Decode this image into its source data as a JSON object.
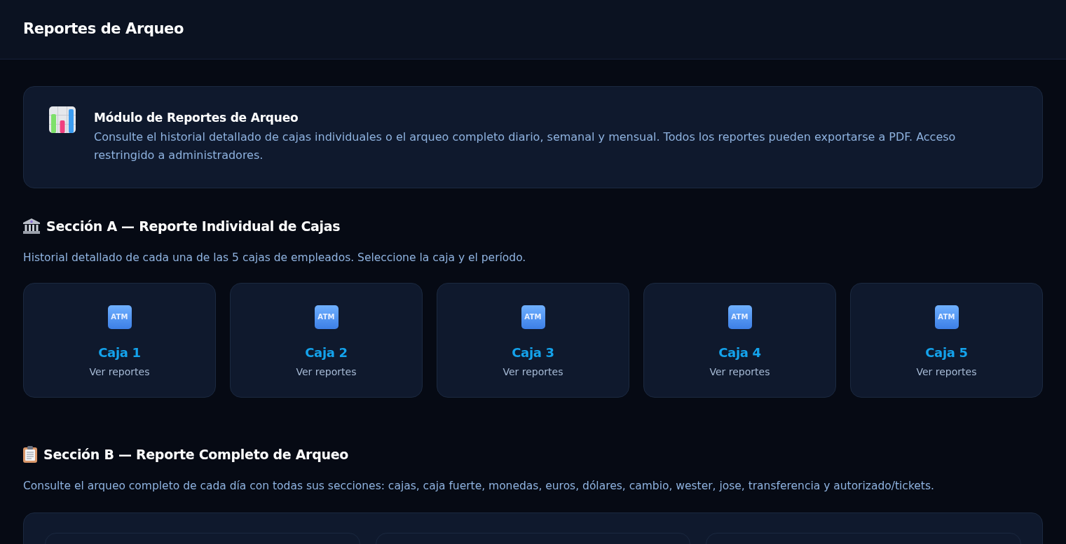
{
  "header": {
    "title": "Reportes de Arqueo"
  },
  "info_card": {
    "title": "Módulo de Reportes de Arqueo",
    "text": "Consulte el historial detallado de cajas individuales o el arqueo completo diario, semanal y mensual. Todos los reportes pueden exportarse a PDF. Acceso restringido a administradores."
  },
  "section_a": {
    "title": "Sección A — Reporte Individual de Cajas",
    "description": "Historial detallado de cada una de las 5 cajas de empleados. Seleccione la caja y el período.",
    "cards": [
      {
        "icon_text": "ATM",
        "title": "Caja 1",
        "subtitle": "Ver reportes"
      },
      {
        "icon_text": "ATM",
        "title": "Caja 2",
        "subtitle": "Ver reportes"
      },
      {
        "icon_text": "ATM",
        "title": "Caja 3",
        "subtitle": "Ver reportes"
      },
      {
        "icon_text": "ATM",
        "title": "Caja 4",
        "subtitle": "Ver reportes"
      },
      {
        "icon_text": "ATM",
        "title": "Caja 5",
        "subtitle": "Ver reportes"
      }
    ]
  },
  "section_b": {
    "title": "Sección B — Reporte Completo de Arqueo",
    "description": "Consulte el arqueo completo de cada día con todas sus secciones: cajas, caja fuerte, monedas, euros, dólares, cambio, wester, jose, transferencia y autorizado/tickets."
  }
}
